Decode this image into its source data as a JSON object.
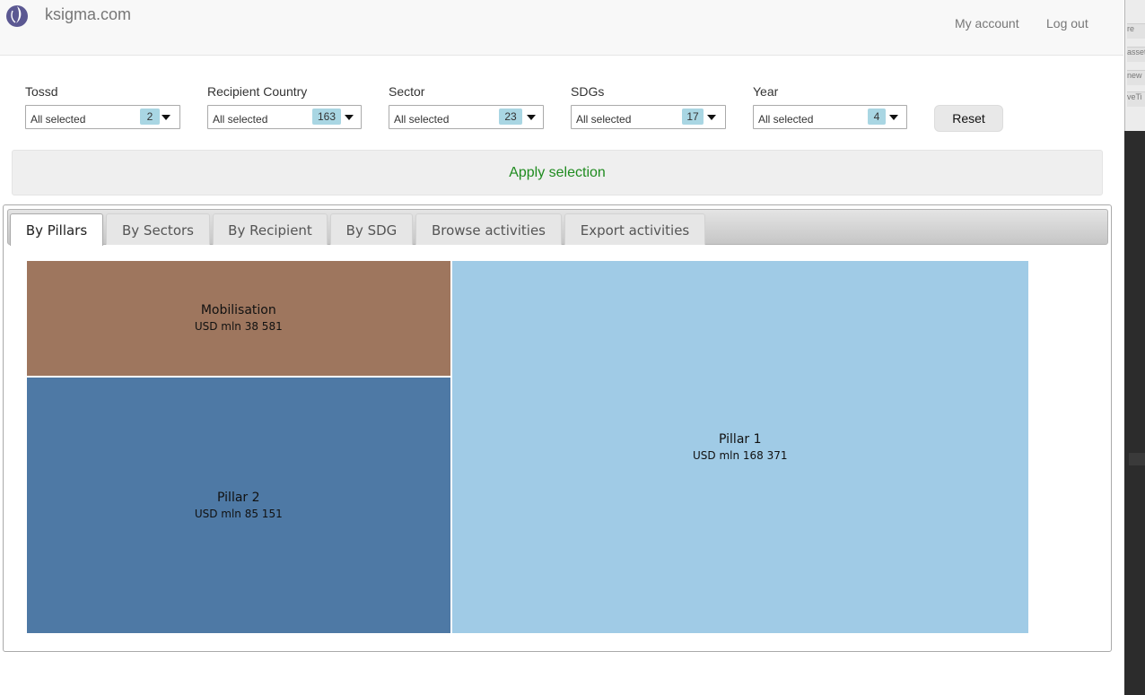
{
  "header": {
    "brand": "ksigma.com",
    "nav": {
      "my_account": "My account",
      "log_out": "Log out"
    }
  },
  "edge_window": {
    "items": [
      "re",
      "asset",
      "new",
      "veTi"
    ]
  },
  "filters": [
    {
      "label": "Tossd",
      "value": "All selected",
      "count": "2"
    },
    {
      "label": "Recipient Country",
      "value": "All selected",
      "count": "163"
    },
    {
      "label": "Sector",
      "value": "All selected",
      "count": "23"
    },
    {
      "label": "SDGs",
      "value": "All selected",
      "count": "17"
    },
    {
      "label": "Year",
      "value": "All selected",
      "count": "4"
    }
  ],
  "reset_label": "Reset",
  "apply_label": "Apply selection",
  "tabs": [
    {
      "label": "By Pillars",
      "active": true
    },
    {
      "label": "By Sectors",
      "active": false
    },
    {
      "label": "By Recipient",
      "active": false
    },
    {
      "label": "By SDG",
      "active": false
    },
    {
      "label": "Browse activities",
      "active": false
    },
    {
      "label": "Export activities",
      "active": false
    }
  ],
  "chart_data": {
    "type": "treemap",
    "unit": "USD mln",
    "items": [
      {
        "name": "Mobilisation",
        "label": "USD mln 38 581",
        "value": 38581,
        "color": "#9e765e"
      },
      {
        "name": "Pillar 2",
        "label": "USD mln 85 151",
        "value": 85151,
        "color": "#4e79a5"
      },
      {
        "name": "Pillar 1",
        "label": "USD mln 168 371",
        "value": 168371,
        "color": "#a0cbe6"
      }
    ]
  }
}
